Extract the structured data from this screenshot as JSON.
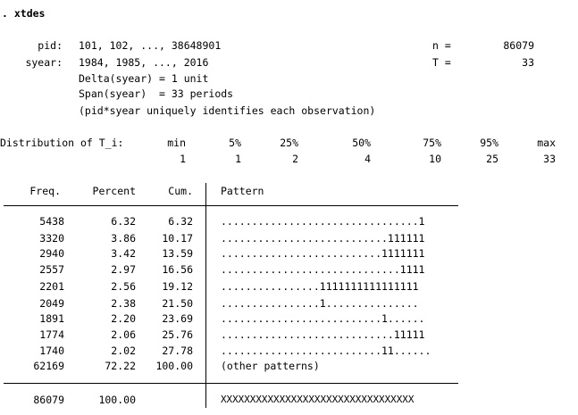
{
  "command": ". xtdes",
  "panel": {
    "pid_label": "pid:",
    "pid_values": "101, 102, ..., 38648901",
    "syear_label": "syear:",
    "syear_values": "1984, 1985, ..., 2016",
    "delta": "Delta(syear) = 1 unit",
    "span": "Span(syear)  = 33 periods",
    "note": "(pid*syear uniquely identifies each observation)",
    "n_label": "n =",
    "n_value": "86079",
    "T_label": "T =",
    "T_value": "33"
  },
  "distribution": {
    "label": "Distribution of T_i:",
    "headers": [
      "min",
      "5%",
      "25%",
      "50%",
      "75%",
      "95%",
      "max"
    ],
    "values": [
      "1",
      "1",
      "2",
      "4",
      "10",
      "25",
      "33"
    ]
  },
  "table": {
    "headers": {
      "freq": "Freq.",
      "percent": "Percent",
      "cum": "Cum.",
      "pattern": "Pattern"
    },
    "rows": [
      {
        "freq": "5438",
        "percent": "6.32",
        "cum": "6.32",
        "pattern": "................................1"
      },
      {
        "freq": "3320",
        "percent": "3.86",
        "cum": "10.17",
        "pattern": "...........................111111"
      },
      {
        "freq": "2940",
        "percent": "3.42",
        "cum": "13.59",
        "pattern": "..........................1111111"
      },
      {
        "freq": "2557",
        "percent": "2.97",
        "cum": "16.56",
        "pattern": ".............................1111"
      },
      {
        "freq": "2201",
        "percent": "2.56",
        "cum": "19.12",
        "pattern": "................1111111111111111"
      },
      {
        "freq": "2049",
        "percent": "2.38",
        "cum": "21.50",
        "pattern": "................1..............."
      },
      {
        "freq": "1891",
        "percent": "2.20",
        "cum": "23.69",
        "pattern": "..........................1......"
      },
      {
        "freq": "1774",
        "percent": "2.06",
        "cum": "25.76",
        "pattern": "............................11111"
      },
      {
        "freq": "1740",
        "percent": "2.02",
        "cum": "27.78",
        "pattern": "..........................11......"
      },
      {
        "freq": "62169",
        "percent": "72.22",
        "cum": "100.00",
        "pattern": "(other patterns)"
      }
    ],
    "total": {
      "freq": "86079",
      "percent": "100.00",
      "pattern": "XXXXXXXXXXXXXXXXXXXXXXXXXXXXXXXXX"
    }
  }
}
